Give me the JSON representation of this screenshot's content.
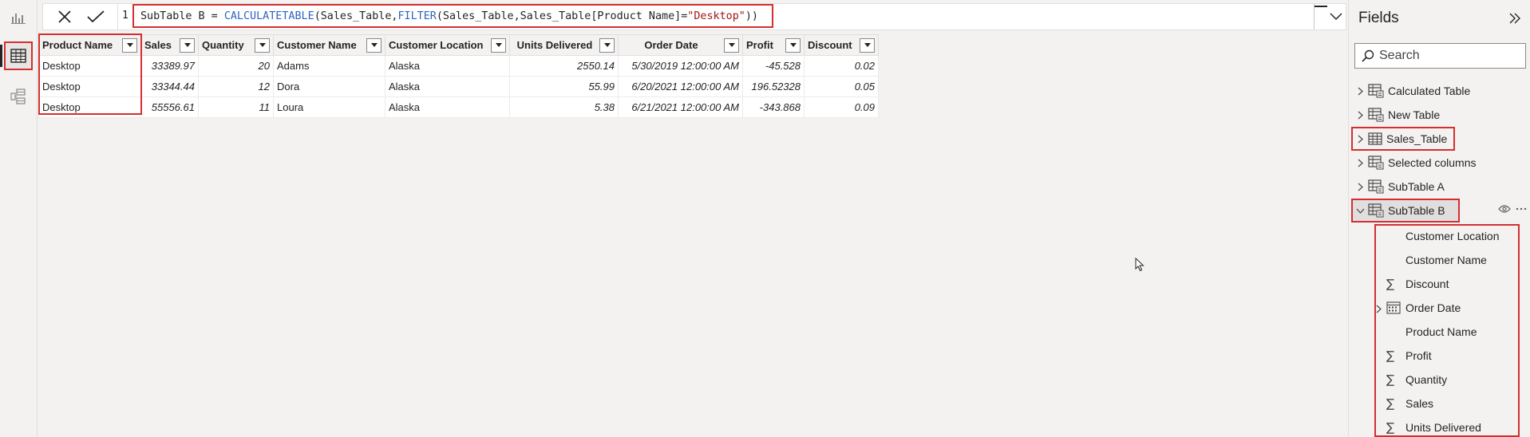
{
  "formula_bar": {
    "line_number": "1",
    "formula": {
      "prefix": "SubTable B = ",
      "fn1": "CALCULATETABLE",
      "mid1": "(Sales_Table,",
      "fn2": "FILTER",
      "mid2": "(Sales_Table,Sales_Table[Product Name]=",
      "str": "\"Desktop\"",
      "suffix": "))"
    }
  },
  "table": {
    "columns": [
      "Product Name",
      "Sales",
      "Quantity",
      "Customer Name",
      "Customer Location",
      "Units Delivered",
      "Order Date",
      "Profit",
      "Discount"
    ],
    "rows": [
      [
        "Desktop",
        "33389.97",
        "20",
        "Adams",
        "Alaska",
        "2550.14",
        "5/30/2019 12:00:00 AM",
        "-45.528",
        "0.02"
      ],
      [
        "Desktop",
        "33344.44",
        "12",
        "Dora",
        "Alaska",
        "55.99",
        "6/20/2021 12:00:00 AM",
        "196.52328",
        "0.05"
      ],
      [
        "Desktop",
        "55556.61",
        "11",
        "Loura",
        "Alaska",
        "5.38",
        "6/21/2021 12:00:00 AM",
        "-343.868",
        "0.09"
      ]
    ]
  },
  "fields_pane": {
    "title": "Fields",
    "search_placeholder": "Search",
    "tables": [
      {
        "name": "Calculated Table"
      },
      {
        "name": "New Table"
      },
      {
        "name": "Sales_Table"
      },
      {
        "name": "Selected columns"
      },
      {
        "name": "SubTable A"
      },
      {
        "name": "SubTable B"
      }
    ],
    "subtable_b_fields": [
      {
        "name": "Customer Location",
        "icon": "none"
      },
      {
        "name": "Customer Name",
        "icon": "none"
      },
      {
        "name": "Discount",
        "icon": "sigma-icon"
      },
      {
        "name": "Order Date",
        "icon": "calendar-icon"
      },
      {
        "name": "Product Name",
        "icon": "none"
      },
      {
        "name": "Profit",
        "icon": "sigma-icon"
      },
      {
        "name": "Quantity",
        "icon": "sigma-icon"
      },
      {
        "name": "Sales",
        "icon": "sigma-icon"
      },
      {
        "name": "Units Delivered",
        "icon": "sigma-icon"
      }
    ],
    "row_actions": [
      "eye-icon",
      "more-icon"
    ]
  },
  "colors": {
    "highlight": "#d32f2f",
    "dax_function": "#3165bb",
    "dax_string": "#a31515"
  }
}
